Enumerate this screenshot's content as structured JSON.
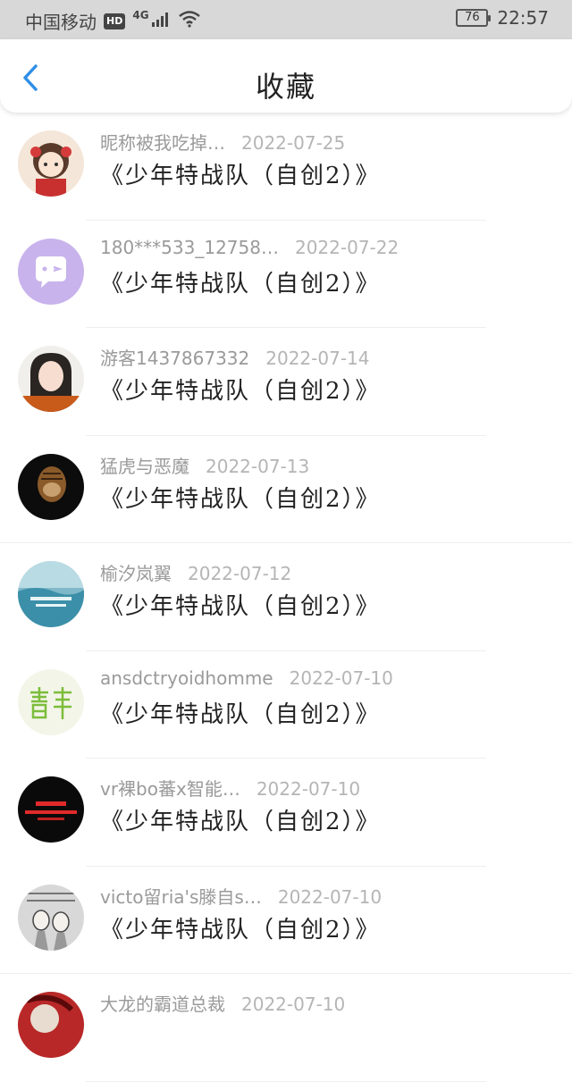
{
  "status_bar": {
    "carrier": "中国移动",
    "hd": "HD",
    "network": "4G",
    "battery": "76",
    "time": "22:57",
    "icons": [
      "signal-icon",
      "wifi-icon",
      "battery-icon"
    ]
  },
  "header": {
    "back_icon": "chevron-left-icon",
    "title": "收藏",
    "accent_color": "#2f8fe8"
  },
  "favorites": [
    {
      "nickname": "昵称被我吃掉…",
      "date": "2022-07-25",
      "work": "《少年特战队（自创2）》",
      "avatar": "cartoon-girl-avatar"
    },
    {
      "nickname": "180***533_12758…",
      "date": "2022-07-22",
      "work": "《少年特战队（自创2）》",
      "avatar": "chat-bubble-avatar"
    },
    {
      "nickname": "游客1437867332",
      "date": "2022-07-14",
      "work": "《少年特战队（自创2）》",
      "avatar": "girl-photo-avatar"
    },
    {
      "nickname": "猛虎与恶魔",
      "date": "2022-07-13",
      "work": "《少年特战队（自创2）》",
      "avatar": "tiger-avatar"
    },
    {
      "nickname": "榆汐岚翼",
      "date": "2022-07-12",
      "work": "《少年特战队（自创2）》",
      "avatar": "sea-landscape-avatar"
    },
    {
      "nickname": "ansdctryoidhomme",
      "date": "2022-07-10",
      "work": "《少年特战队（自创2）》",
      "avatar": "green-character-avatar"
    },
    {
      "nickname": "vr裸bo蕃x智能…",
      "date": "2022-07-10",
      "work": "《少年特战队（自创2）》",
      "avatar": "red-text-avatar"
    },
    {
      "nickname": "victo留ria's滕自s…",
      "date": "2022-07-10",
      "work": "《少年特战队（自创2）》",
      "avatar": "anime-sketch-avatar"
    },
    {
      "nickname": "大龙的霸道总裁",
      "date": "2022-07-10",
      "work": "",
      "avatar": "red-anime-avatar"
    }
  ]
}
